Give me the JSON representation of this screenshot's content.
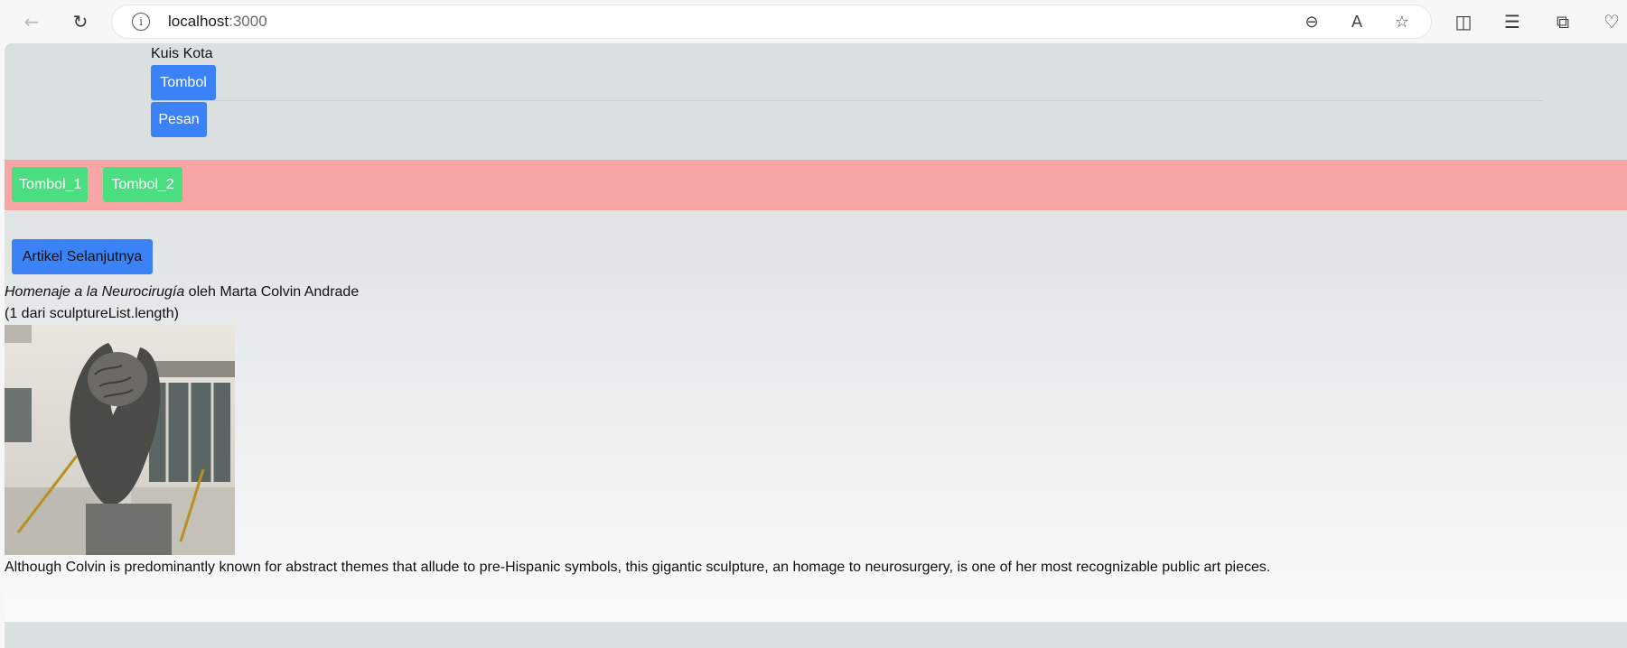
{
  "browser": {
    "url_host": "localhost",
    "url_port": ":3000"
  },
  "quiz": {
    "title": "Kuis Kota",
    "button_label": "Tombol",
    "message_label": "Pesan"
  },
  "toolbar_band": {
    "button1_label": "Tombol_1",
    "button2_label": "Tombol_2"
  },
  "gallery": {
    "next_label": "Artikel Selanjutnya",
    "title_italic": "Homenaje a la Neurocirugía",
    "title_rest": " oleh Marta Colvin Andrade",
    "count_text": "(1 dari sculptureList.length)",
    "description": "Although Colvin is predominantly known for abstract themes that allude to pre-Hispanic symbols, this gigantic sculpture, an homage to neurosurgery, is one of her most recognizable public art pieces."
  },
  "colors": {
    "blue_button": "#3b82f6",
    "green_button": "#4ade80",
    "red_band": "#f8a5a5"
  }
}
